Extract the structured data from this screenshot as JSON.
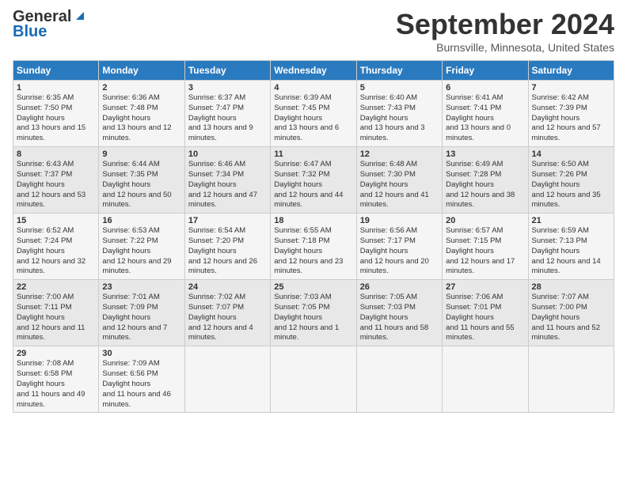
{
  "header": {
    "logo_general": "General",
    "logo_blue": "Blue",
    "title": "September 2024",
    "location": "Burnsville, Minnesota, United States"
  },
  "days_of_week": [
    "Sunday",
    "Monday",
    "Tuesday",
    "Wednesday",
    "Thursday",
    "Friday",
    "Saturday"
  ],
  "weeks": [
    [
      {
        "day": "1",
        "rise": "6:35 AM",
        "set": "7:50 PM",
        "daylight": "13 hours and 15 minutes."
      },
      {
        "day": "2",
        "rise": "6:36 AM",
        "set": "7:48 PM",
        "daylight": "13 hours and 12 minutes."
      },
      {
        "day": "3",
        "rise": "6:37 AM",
        "set": "7:47 PM",
        "daylight": "13 hours and 9 minutes."
      },
      {
        "day": "4",
        "rise": "6:39 AM",
        "set": "7:45 PM",
        "daylight": "13 hours and 6 minutes."
      },
      {
        "day": "5",
        "rise": "6:40 AM",
        "set": "7:43 PM",
        "daylight": "13 hours and 3 minutes."
      },
      {
        "day": "6",
        "rise": "6:41 AM",
        "set": "7:41 PM",
        "daylight": "13 hours and 0 minutes."
      },
      {
        "day": "7",
        "rise": "6:42 AM",
        "set": "7:39 PM",
        "daylight": "12 hours and 57 minutes."
      }
    ],
    [
      {
        "day": "8",
        "rise": "6:43 AM",
        "set": "7:37 PM",
        "daylight": "12 hours and 53 minutes."
      },
      {
        "day": "9",
        "rise": "6:44 AM",
        "set": "7:35 PM",
        "daylight": "12 hours and 50 minutes."
      },
      {
        "day": "10",
        "rise": "6:46 AM",
        "set": "7:34 PM",
        "daylight": "12 hours and 47 minutes."
      },
      {
        "day": "11",
        "rise": "6:47 AM",
        "set": "7:32 PM",
        "daylight": "12 hours and 44 minutes."
      },
      {
        "day": "12",
        "rise": "6:48 AM",
        "set": "7:30 PM",
        "daylight": "12 hours and 41 minutes."
      },
      {
        "day": "13",
        "rise": "6:49 AM",
        "set": "7:28 PM",
        "daylight": "12 hours and 38 minutes."
      },
      {
        "day": "14",
        "rise": "6:50 AM",
        "set": "7:26 PM",
        "daylight": "12 hours and 35 minutes."
      }
    ],
    [
      {
        "day": "15",
        "rise": "6:52 AM",
        "set": "7:24 PM",
        "daylight": "12 hours and 32 minutes."
      },
      {
        "day": "16",
        "rise": "6:53 AM",
        "set": "7:22 PM",
        "daylight": "12 hours and 29 minutes."
      },
      {
        "day": "17",
        "rise": "6:54 AM",
        "set": "7:20 PM",
        "daylight": "12 hours and 26 minutes."
      },
      {
        "day": "18",
        "rise": "6:55 AM",
        "set": "7:18 PM",
        "daylight": "12 hours and 23 minutes."
      },
      {
        "day": "19",
        "rise": "6:56 AM",
        "set": "7:17 PM",
        "daylight": "12 hours and 20 minutes."
      },
      {
        "day": "20",
        "rise": "6:57 AM",
        "set": "7:15 PM",
        "daylight": "12 hours and 17 minutes."
      },
      {
        "day": "21",
        "rise": "6:59 AM",
        "set": "7:13 PM",
        "daylight": "12 hours and 14 minutes."
      }
    ],
    [
      {
        "day": "22",
        "rise": "7:00 AM",
        "set": "7:11 PM",
        "daylight": "12 hours and 11 minutes."
      },
      {
        "day": "23",
        "rise": "7:01 AM",
        "set": "7:09 PM",
        "daylight": "12 hours and 7 minutes."
      },
      {
        "day": "24",
        "rise": "7:02 AM",
        "set": "7:07 PM",
        "daylight": "12 hours and 4 minutes."
      },
      {
        "day": "25",
        "rise": "7:03 AM",
        "set": "7:05 PM",
        "daylight": "12 hours and 1 minute."
      },
      {
        "day": "26",
        "rise": "7:05 AM",
        "set": "7:03 PM",
        "daylight": "11 hours and 58 minutes."
      },
      {
        "day": "27",
        "rise": "7:06 AM",
        "set": "7:01 PM",
        "daylight": "11 hours and 55 minutes."
      },
      {
        "day": "28",
        "rise": "7:07 AM",
        "set": "7:00 PM",
        "daylight": "11 hours and 52 minutes."
      }
    ],
    [
      {
        "day": "29",
        "rise": "7:08 AM",
        "set": "6:58 PM",
        "daylight": "11 hours and 49 minutes."
      },
      {
        "day": "30",
        "rise": "7:09 AM",
        "set": "6:56 PM",
        "daylight": "11 hours and 46 minutes."
      },
      null,
      null,
      null,
      null,
      null
    ]
  ]
}
